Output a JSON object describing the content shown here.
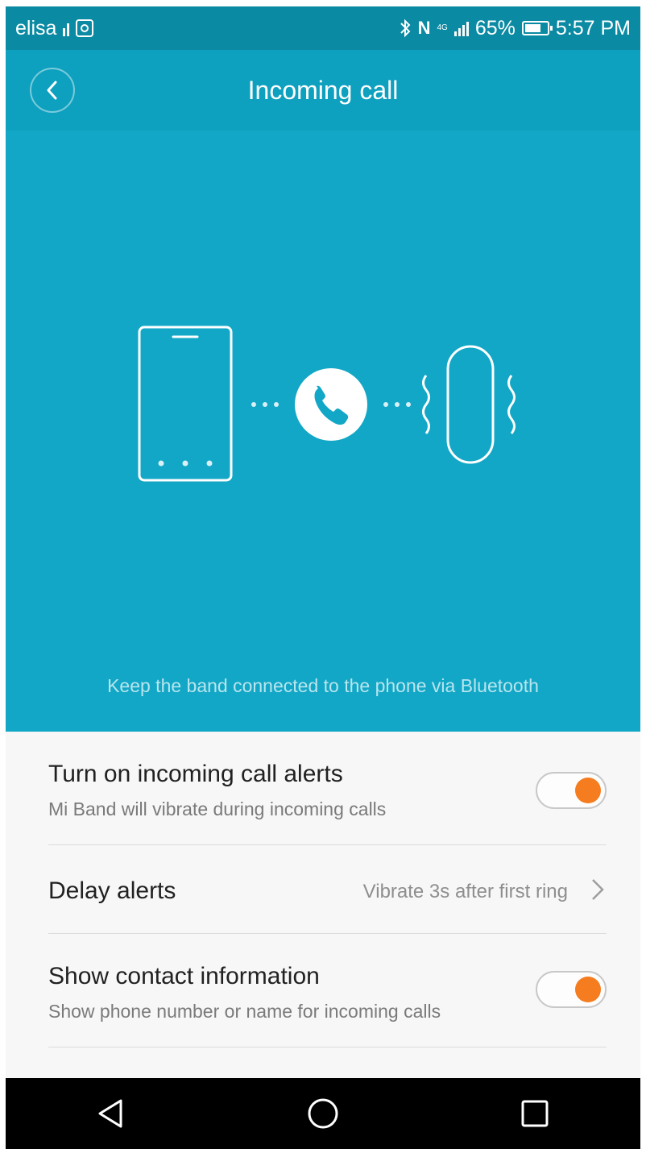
{
  "status_bar": {
    "carrier": "elisa",
    "battery_percent": "65%",
    "time": "5:57 PM",
    "network_type": "4G"
  },
  "header": {
    "title": "Incoming call"
  },
  "hero": {
    "caption": "Keep the band connected to the phone via Bluetooth"
  },
  "settings": [
    {
      "title": "Turn on incoming call alerts",
      "subtitle": "Mi Band will vibrate during incoming calls",
      "enabled": true
    },
    {
      "title": "Delay alerts",
      "value": "Vibrate 3s after first ring"
    },
    {
      "title": "Show contact information",
      "subtitle": "Show phone number or name for incoming calls",
      "enabled": true
    }
  ],
  "colors": {
    "status_bar": "#0b8aa3",
    "header": "#0ea0bf",
    "hero": "#12a7c6",
    "toggle_knob": "#f57c1f"
  },
  "icons": [
    "back-icon",
    "phone-icon",
    "call-icon",
    "band-icon",
    "vibration-icon",
    "chevron-right-icon",
    "nav-back-icon",
    "nav-home-icon",
    "nav-recents-icon"
  ]
}
